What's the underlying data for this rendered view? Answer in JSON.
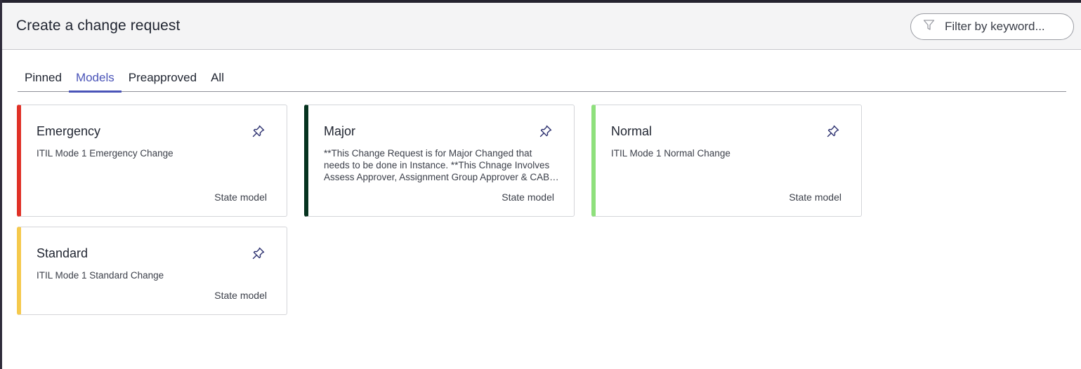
{
  "header": {
    "title": "Create a change request",
    "filter_placeholder": "Filter by keyword..."
  },
  "tabs": [
    {
      "label": "Pinned",
      "active": false
    },
    {
      "label": "Models",
      "active": true
    },
    {
      "label": "Preapproved",
      "active": false
    },
    {
      "label": "All",
      "active": false
    }
  ],
  "cards": [
    {
      "title": "Emergency",
      "description": "ITIL Mode 1 Emergency Change",
      "footer": "State model",
      "accent_color": "#e03127",
      "icon": "pin-icon"
    },
    {
      "title": "Major",
      "description": "**This Change Request is for Major Changed that needs to be done in Instance. **This Chnage Involves Assess Approver, Assignment Group Approver & CAB Approver",
      "footer": "State model",
      "accent_color": "#06331f",
      "icon": "pin-icon"
    },
    {
      "title": "Normal",
      "description": "ITIL Mode 1 Normal Change",
      "footer": "State model",
      "accent_color": "#8ee07c",
      "icon": "pin-icon"
    },
    {
      "title": "Standard",
      "description": "ITIL Mode 1 Standard Change",
      "footer": "State model",
      "accent_color": "#f5c94c",
      "icon": "pin-icon"
    }
  ],
  "colors": {
    "tab_active": "#4a54b8",
    "header_bg": "#f4f4f5"
  }
}
